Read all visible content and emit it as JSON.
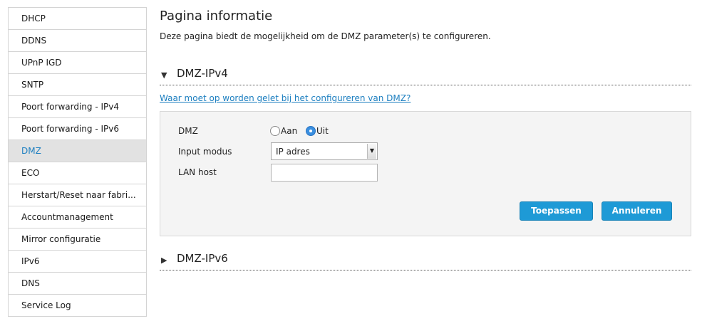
{
  "sidebar": {
    "items": [
      {
        "label": "DHCP"
      },
      {
        "label": "DDNS"
      },
      {
        "label": "UPnP IGD"
      },
      {
        "label": "SNTP"
      },
      {
        "label": "Poort forwarding - IPv4"
      },
      {
        "label": "Poort forwarding - IPv6"
      },
      {
        "label": "DMZ"
      },
      {
        "label": "ECO"
      },
      {
        "label": "Herstart/Reset naar fabri..."
      },
      {
        "label": "Accountmanagement"
      },
      {
        "label": "Mirror configuratie"
      },
      {
        "label": "IPv6"
      },
      {
        "label": "DNS"
      },
      {
        "label": "Service Log"
      }
    ],
    "active_index": 6
  },
  "page": {
    "title": "Pagina informatie",
    "description": "Deze pagina biedt de mogelijkheid om de DMZ parameter(s) te configureren."
  },
  "section_ipv4": {
    "title": "DMZ-IPv4",
    "expanded": true,
    "help_link": "Waar moet op worden gelet bij het configureren van DMZ?",
    "form": {
      "dmz_label": "DMZ",
      "radio_on_label": "Aan",
      "radio_off_label": "Uit",
      "selected_radio": "Uit",
      "input_mode_label": "Input modus",
      "input_mode_value": "IP adres",
      "lan_host_label": "LAN host",
      "lan_host_value": ""
    },
    "apply_label": "Toepassen",
    "cancel_label": "Annuleren"
  },
  "section_ipv6": {
    "title": "DMZ-IPv6",
    "expanded": false
  },
  "colors": {
    "accent": "#1e9ad6",
    "link": "#1d7fc0",
    "active_bg": "#e2e2e2",
    "panel_bg": "#f4f4f4"
  }
}
